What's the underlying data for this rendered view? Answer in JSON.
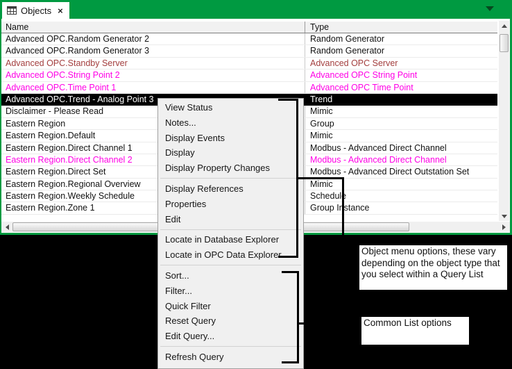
{
  "window": {
    "tab": {
      "title": "Objects",
      "close_glyph": "×"
    },
    "accent_green": "#009A41",
    "caret_color": "#07481e"
  },
  "icons": {
    "tab": "table-grid-icon",
    "tab_close": "close-icon",
    "titlebar_caret": "chevron-down-icon",
    "scroll_up": "▲",
    "scroll_down": "▼",
    "scroll_left": "◄",
    "scroll_right": "►"
  },
  "table": {
    "columns": {
      "name": "Name",
      "type": "Type"
    },
    "colors": {
      "red": "#A33E3E",
      "magenta": "#FF00E6",
      "selected_bg": "#000000",
      "selected_fg": "#FFFFFF"
    },
    "rows": [
      {
        "name": "Advanced OPC.Random Generator 2",
        "type": "Random Generator",
        "color": "default"
      },
      {
        "name": "Advanced OPC.Random Generator 3",
        "type": "Random Generator",
        "color": "default"
      },
      {
        "name": "Advanced OPC.Standby Server",
        "type": "Advanced OPC Server",
        "color": "red"
      },
      {
        "name": "Advanced OPC.String Point 2",
        "type": "Advanced OPC String Point",
        "color": "magenta"
      },
      {
        "name": "Advanced OPC.Time Point 1",
        "type": "Advanced OPC Time Point",
        "color": "magenta"
      },
      {
        "name": "Advanced OPC.Trend - Analog Point 3",
        "type": "Trend",
        "color": "selected"
      },
      {
        "name": "Disclaimer - Please Read",
        "type": "Mimic",
        "color": "default"
      },
      {
        "name": "Eastern Region",
        "type": "Group",
        "color": "default"
      },
      {
        "name": "Eastern Region.Default",
        "type": "Mimic",
        "color": "default"
      },
      {
        "name": "Eastern Region.Direct Channel 1",
        "type": "Modbus - Advanced Direct Channel",
        "color": "default"
      },
      {
        "name": "Eastern Region.Direct Channel 2",
        "type": "Modbus - Advanced Direct Channel",
        "color": "magenta"
      },
      {
        "name": "Eastern Region.Direct Set",
        "type": "Modbus - Advanced Direct Outstation Set",
        "color": "default"
      },
      {
        "name": "Eastern Region.Regional Overview",
        "type": "Mimic",
        "color": "default"
      },
      {
        "name": "Eastern Region.Weekly Schedule",
        "type": "Schedule",
        "color": "default"
      },
      {
        "name": "Eastern Region.Zone 1",
        "type": "Group Instance",
        "color": "default"
      }
    ]
  },
  "context_menu": {
    "items": [
      {
        "label": "View Status"
      },
      {
        "label": "Notes..."
      },
      {
        "label": "Display Events"
      },
      {
        "label": "Display"
      },
      {
        "label": "Display Property Changes"
      },
      {
        "separator": true
      },
      {
        "label": "Display References"
      },
      {
        "label": "Properties"
      },
      {
        "label": "Edit"
      },
      {
        "separator": true
      },
      {
        "label": "Locate in Database Explorer"
      },
      {
        "label": "Locate in OPC Data Explorer"
      },
      {
        "separator": true
      },
      {
        "label": "Sort..."
      },
      {
        "label": "Filter..."
      },
      {
        "label": "Quick Filter"
      },
      {
        "label": "Reset Query"
      },
      {
        "label": "Edit Query..."
      },
      {
        "separator": true
      },
      {
        "label": "Refresh Query"
      }
    ]
  },
  "annotations": {
    "box1": {
      "text": "Object menu options, these vary depending on the object type that you select within a Query List"
    },
    "box2": {
      "text": "Common List options"
    }
  }
}
